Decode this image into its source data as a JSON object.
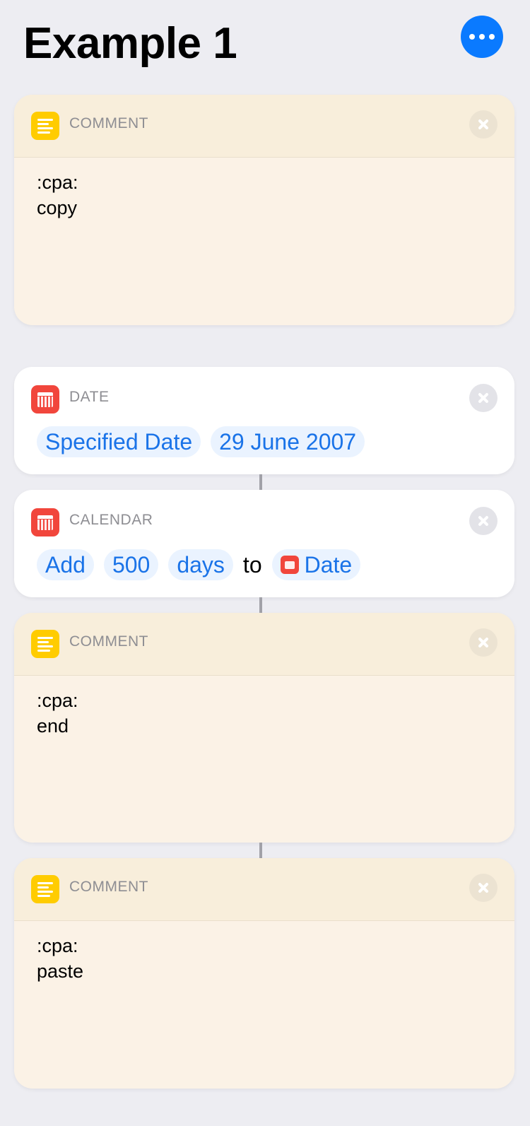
{
  "header": {
    "title": "Example 1",
    "more_icon": "ellipsis-icon",
    "accent": "#0a7aff"
  },
  "actions": [
    {
      "type": "comment",
      "label": "COMMENT",
      "text": ":cpa:\ncopy",
      "icon": "comment-lines-icon",
      "color": "#ffcc00"
    },
    {
      "type": "date",
      "label": "DATE",
      "icon": "calendar-icon",
      "color": "#f1463c",
      "params": [
        "Specified Date",
        "29 June 2007"
      ]
    },
    {
      "type": "calendar",
      "label": "CALENDAR",
      "icon": "calendar-icon",
      "color": "#f1463c",
      "tokens": {
        "verb": "Add",
        "amount": "500",
        "unit": "days",
        "joiner": "to",
        "variable": "Date"
      }
    },
    {
      "type": "comment",
      "label": "COMMENT",
      "text": ":cpa:\nend",
      "icon": "comment-lines-icon",
      "color": "#ffcc00"
    },
    {
      "type": "comment",
      "label": "COMMENT",
      "text": ":cpa:\npaste",
      "icon": "comment-lines-icon",
      "color": "#ffcc00"
    }
  ]
}
